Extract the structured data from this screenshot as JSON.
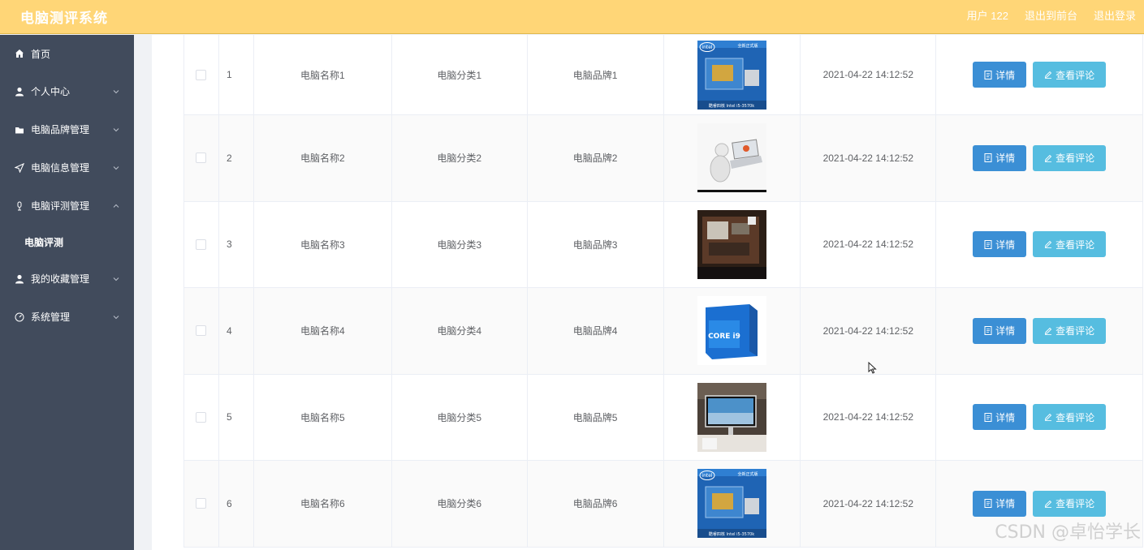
{
  "header": {
    "title": "电脑测评系统",
    "user_label": "用户 122",
    "back_label": "退出到前台",
    "logout_label": "退出登录"
  },
  "sidebar": {
    "items": [
      {
        "label": "首页",
        "icon": "home-icon",
        "chevron": "none"
      },
      {
        "label": "个人中心",
        "icon": "user-icon",
        "chevron": "down"
      },
      {
        "label": "电脑品牌管理",
        "icon": "folder-icon",
        "chevron": "down"
      },
      {
        "label": "电脑信息管理",
        "icon": "send-icon",
        "chevron": "down"
      },
      {
        "label": "电脑评测管理",
        "icon": "microphone-icon",
        "chevron": "up"
      },
      {
        "label": "我的收藏管理",
        "icon": "user-icon",
        "chevron": "down"
      },
      {
        "label": "系统管理",
        "icon": "gauge-icon",
        "chevron": "down"
      }
    ],
    "subitem": {
      "label": "电脑评测"
    }
  },
  "table": {
    "detail_label": "详情",
    "review_label": "查看评论",
    "rows": [
      {
        "index": "1",
        "name": "电脑名称1",
        "category": "电脑分类1",
        "brand": "电脑品牌1",
        "time": "2021-04-22 14:12:52",
        "image": "intel-cpu-box"
      },
      {
        "index": "2",
        "name": "电脑名称2",
        "category": "电脑分类2",
        "brand": "电脑品牌2",
        "time": "2021-04-22 14:12:52",
        "image": "figure-with-laptop"
      },
      {
        "index": "3",
        "name": "电脑名称3",
        "category": "电脑分类3",
        "brand": "电脑品牌3",
        "time": "2021-04-22 14:12:52",
        "image": "opened-computer-case"
      },
      {
        "index": "4",
        "name": "电脑名称4",
        "category": "电脑分类4",
        "brand": "电脑品牌4",
        "time": "2021-04-22 14:12:52",
        "image": "intel-core-i9-box"
      },
      {
        "index": "5",
        "name": "电脑名称5",
        "category": "电脑分类5",
        "brand": "电脑品牌5",
        "time": "2021-04-22 14:12:52",
        "image": "monitor-on-desk"
      },
      {
        "index": "6",
        "name": "电脑名称6",
        "category": "电脑分类6",
        "brand": "电脑品牌6",
        "time": "2021-04-22 14:12:52",
        "image": "intel-cpu-box"
      }
    ]
  },
  "image_text": {
    "intel_logo": "intel",
    "intel_box_top": "全新正式版",
    "intel_box_bottom": "酷睿四核 Intel i5-3570k",
    "core_i9": "CORE i9"
  },
  "watermark": "CSDN @卓怡学长",
  "colors": {
    "header_bg": "#ffd677",
    "sidebar_bg": "#414b5c",
    "detail_button": "#3b8fd5",
    "review_button": "#56bde0"
  }
}
